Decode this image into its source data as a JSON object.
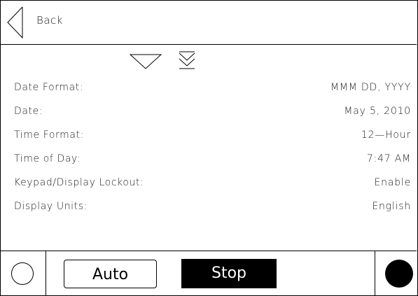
{
  "header": {
    "back_label": "Back"
  },
  "icons": {
    "back": "chevron-left-icon",
    "scroll_down": "triangle-down-icon",
    "scroll_to_end": "double-chevron-down-icon"
  },
  "settings": [
    {
      "label": "Date Format:",
      "value": "MMM DD, YYYY"
    },
    {
      "label": "Date:",
      "value": "May 5, 2010"
    },
    {
      "label": "Time Format:",
      "value": "12—Hour"
    },
    {
      "label": "Time of Day:",
      "value": "7:47 AM"
    },
    {
      "label": "Keypad/Display Lockout:",
      "value": "Enable"
    },
    {
      "label": "Display Units:",
      "value": "English"
    }
  ],
  "footer": {
    "auto_label": "Auto",
    "stop_label": "Stop"
  },
  "colors": {
    "foreground": "#000000",
    "background": "#ffffff"
  }
}
